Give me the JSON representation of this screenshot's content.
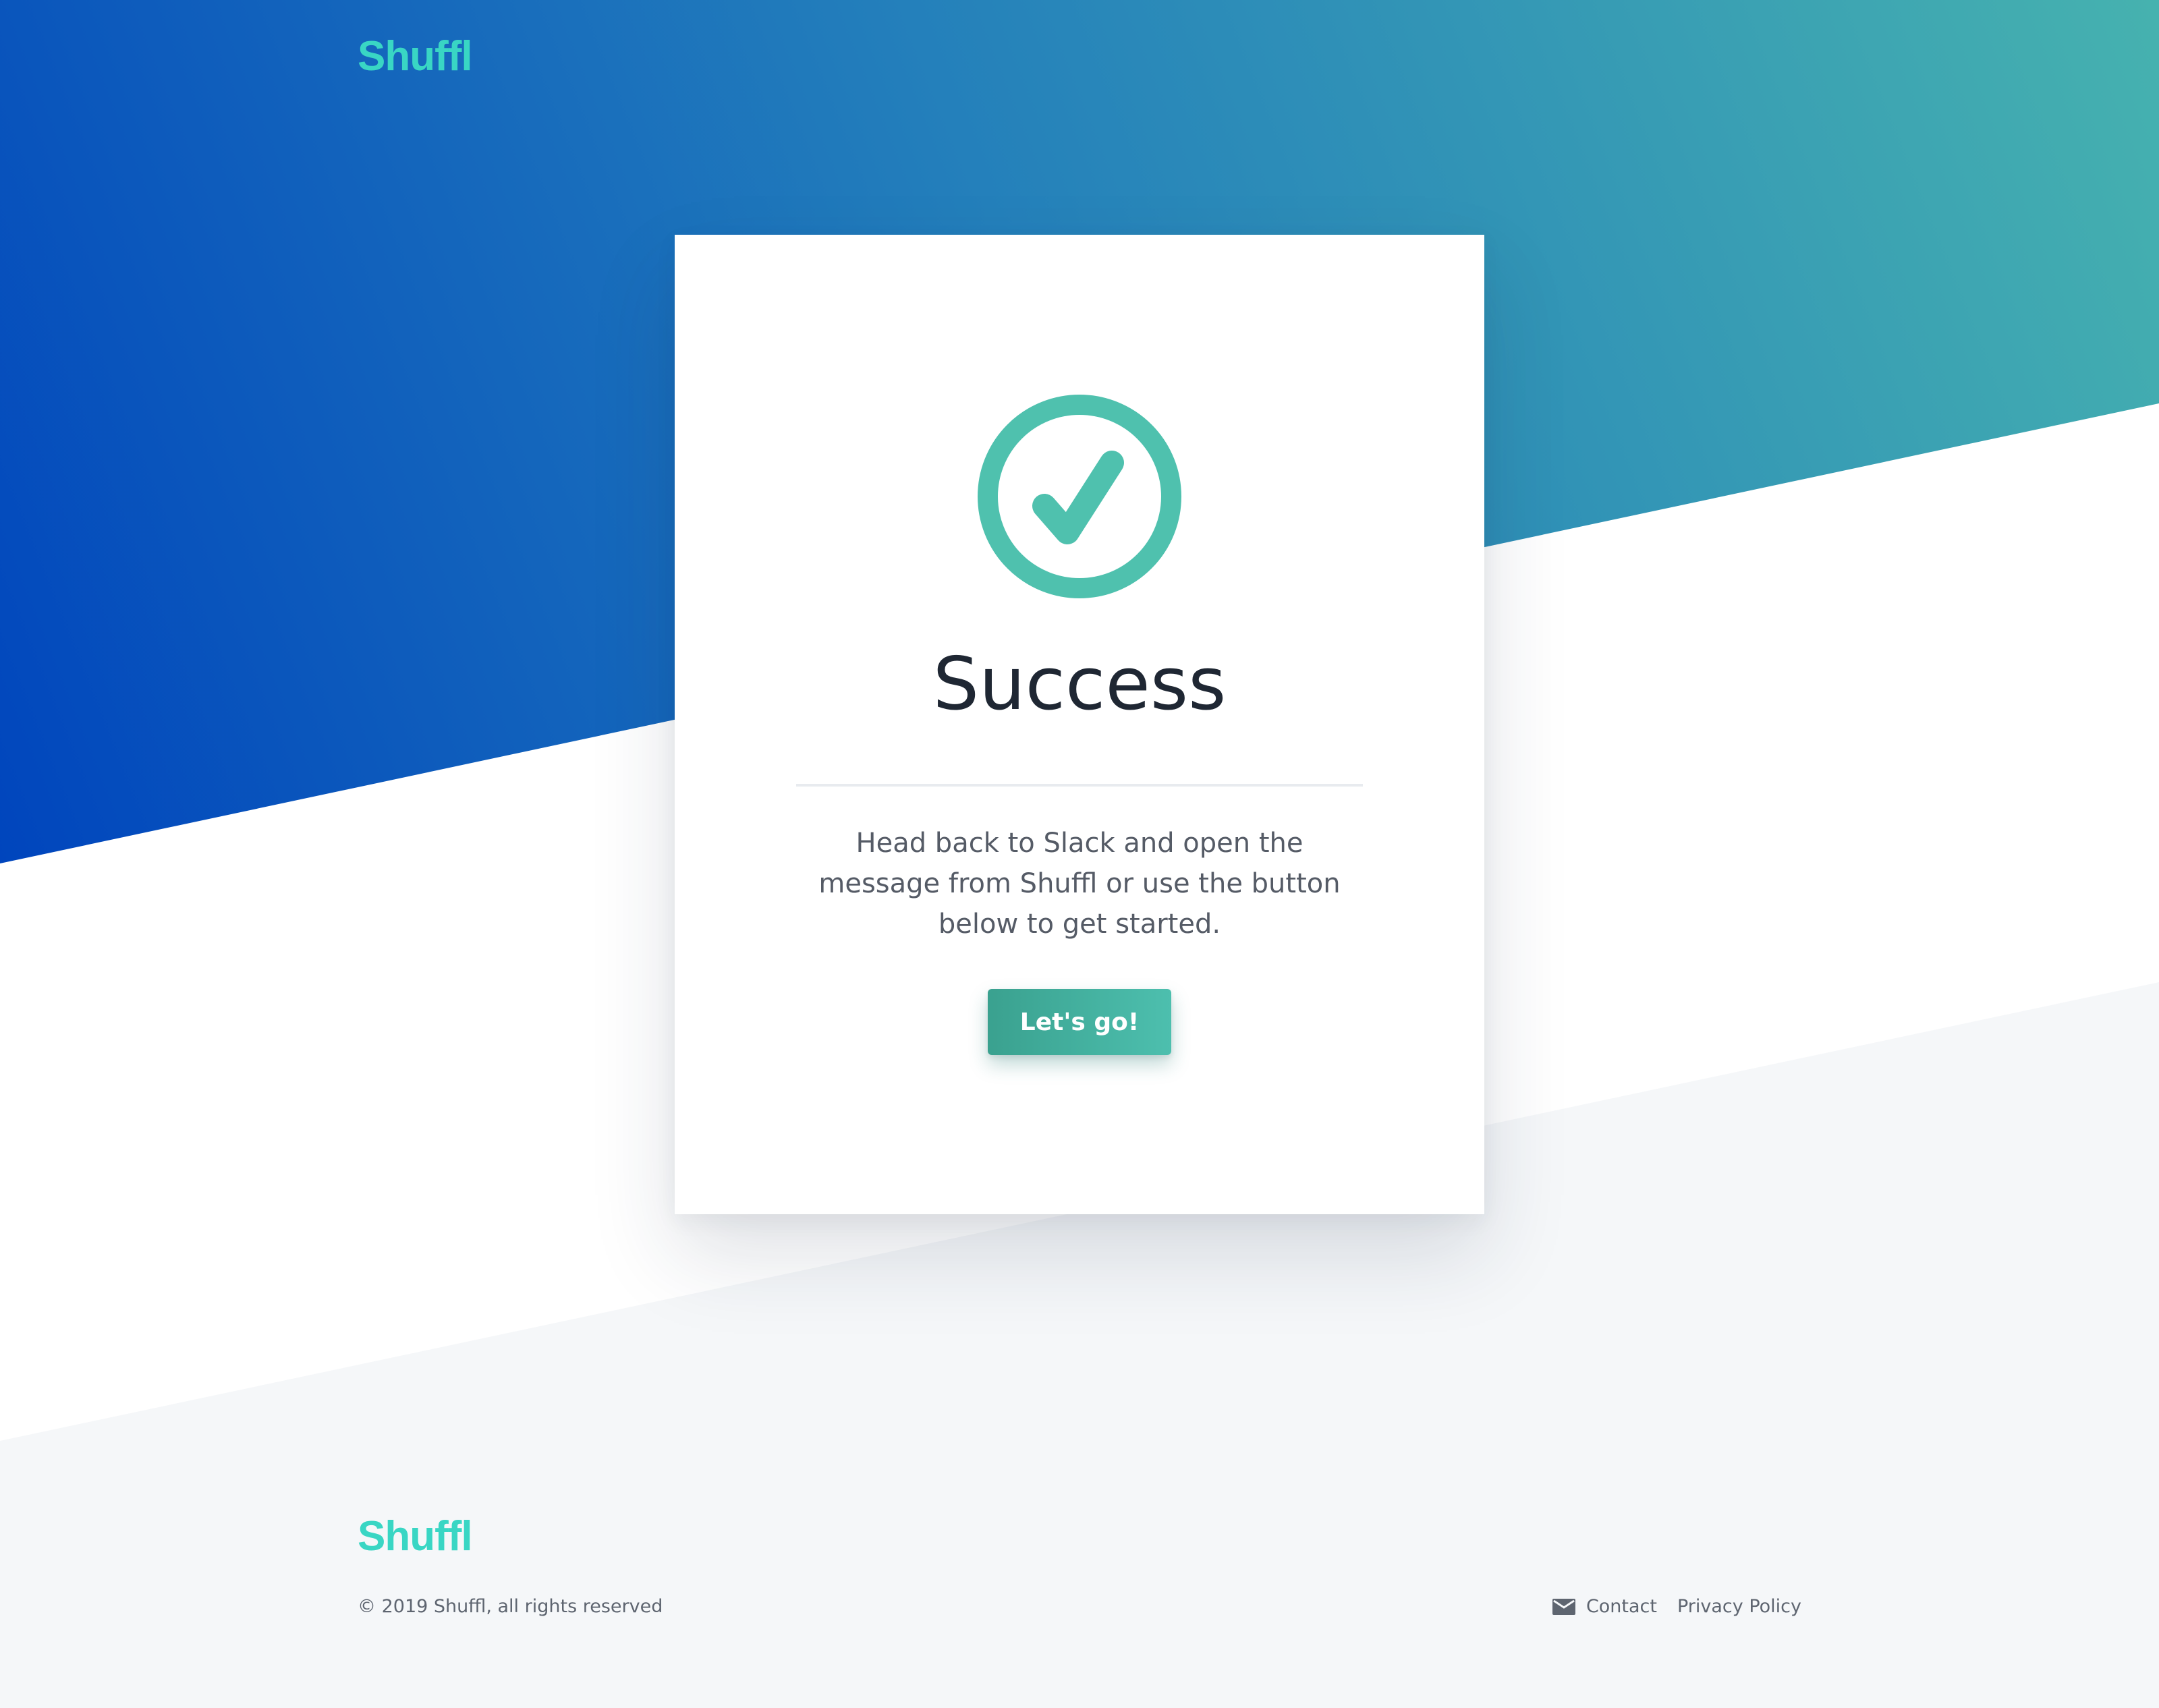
{
  "colors": {
    "gradient_start": "#0045bd",
    "gradient_end": "#46b2af",
    "accent": "#4fc1ae",
    "logo": "#39d6c4",
    "footer_bg": "#f5f7f9",
    "title_text": "#1f2733",
    "body_text": "#555b66"
  },
  "header": {
    "logo": "Shuffl"
  },
  "card": {
    "icon": "check-circle-icon",
    "title": "Success",
    "message": "Head back to Slack and open the message from Shuffl or use the button below to get started.",
    "button_label": "Let's go!"
  },
  "footer": {
    "logo": "Shuffl",
    "copyright": "© 2019 Shuffl, all rights reserved",
    "contact_icon": "mail-icon",
    "contact_label": "Contact",
    "privacy_label": "Privacy Policy"
  }
}
